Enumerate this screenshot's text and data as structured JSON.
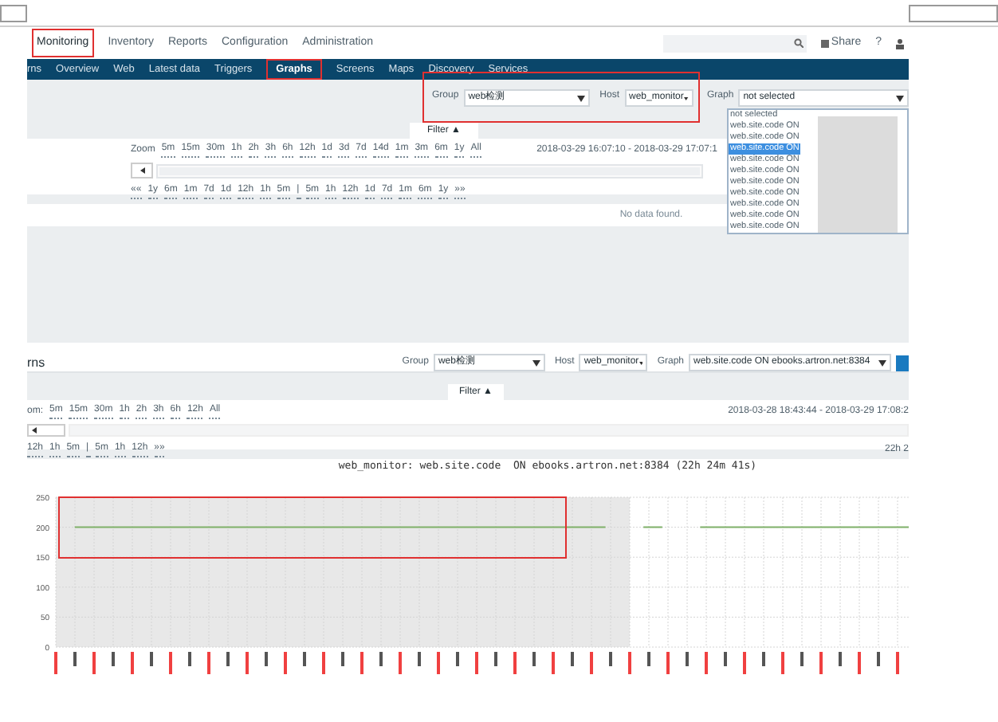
{
  "screenshot_1": {
    "top_menu": [
      {
        "label": "Monitoring",
        "selected": true
      },
      {
        "label": "Inventory",
        "selected": false
      },
      {
        "label": "Reports",
        "selected": false
      },
      {
        "label": "Configuration",
        "selected": false
      },
      {
        "label": "Administration",
        "selected": false
      }
    ],
    "share": "Share",
    "help": "?",
    "nav": [
      {
        "label": "rns",
        "selected": false
      },
      {
        "label": "Overview",
        "selected": false
      },
      {
        "label": "Web",
        "selected": false
      },
      {
        "label": "Latest data",
        "selected": false
      },
      {
        "label": "Triggers",
        "selected": false
      },
      {
        "label": "Graphs",
        "selected": true
      },
      {
        "label": "Screens",
        "selected": false
      },
      {
        "label": "Maps",
        "selected": false
      },
      {
        "label": "Discovery",
        "selected": false
      },
      {
        "label": "Services",
        "selected": false
      }
    ],
    "filter": {
      "group_label": "Group",
      "group_value": "web检测",
      "host_label": "Host",
      "host_value": "web_monitor",
      "graph_label": "Graph",
      "graph_value": "not selected",
      "graph_options": [
        {
          "label": "not selected",
          "selected": false
        },
        {
          "label": "web.site.code ON",
          "selected": false
        },
        {
          "label": "web.site.code ON",
          "selected": false
        },
        {
          "label": "web.site.code ON",
          "selected": true
        },
        {
          "label": "web.site.code ON",
          "selected": false
        },
        {
          "label": "web.site.code ON",
          "selected": false
        },
        {
          "label": "web.site.code ON",
          "selected": false
        },
        {
          "label": "web.site.code ON",
          "selected": false
        },
        {
          "label": "web.site.code ON",
          "selected": false
        },
        {
          "label": "web.site.code ON",
          "selected": false
        },
        {
          "label": "web.site.code ON",
          "selected": false
        }
      ]
    },
    "filter_tab": "Filter ▲",
    "zoom_label": "Zoom",
    "zoom_options": [
      "5m",
      "15m",
      "30m",
      "1h",
      "2h",
      "3h",
      "6h",
      "12h",
      "1d",
      "3d",
      "7d",
      "14d",
      "1m",
      "3m",
      "6m",
      "1y",
      "All"
    ],
    "period": "2018-03-29 16:07:10 - 2018-03-29 17:07:1",
    "slider": {
      "level": 1
    },
    "nav_links": [
      "««",
      "1y",
      "6m",
      "1m",
      "7d",
      "1d",
      "12h",
      "1h",
      "5m",
      "|",
      "5m",
      "1h",
      "12h",
      "1d",
      "7d",
      "1m",
      "6m",
      "1y",
      "»»"
    ],
    "message": "No data found."
  },
  "screenshot_2": {
    "title": "rns",
    "filter": {
      "group_label": "Group",
      "group_value": "web检测",
      "host_label": "Host",
      "host_value": "web_monitor",
      "graph_label": "Graph",
      "graph_value": "web.site.code ON ebooks.artron.net:8384"
    },
    "filter_tab": "Filter ▲",
    "zoom_label": "om:",
    "zoom_options": [
      "5m",
      "15m",
      "30m",
      "1h",
      "2h",
      "3h",
      "6h",
      "12h",
      "All"
    ],
    "period": "2018-03-28 18:43:44 - 2018-03-29 17:08:2",
    "slider": {
      "level": 1
    },
    "nav_links": [
      "12h",
      "1h",
      "5m",
      "|",
      "5m",
      "1h",
      "12h",
      "»»"
    ],
    "duration": "22h 2",
    "chart_data": {
      "type": "line",
      "grid": true,
      "title": "web_monitor: web.site.code  ON ebooks.artron.net:8384 (22h 24m 41s)",
      "ylim": [
        0,
        250
      ],
      "yticks": [
        0,
        50,
        100,
        150,
        200,
        250
      ],
      "series": [
        {
          "color": "#7fb069",
          "values": [
            null,
            200,
            200,
            200,
            200,
            200,
            200,
            200,
            200,
            200,
            200,
            200,
            200,
            200,
            200,
            200,
            200,
            200,
            200,
            200,
            200,
            200,
            200,
            200,
            200,
            200,
            200,
            200,
            200,
            200,
            null,
            200,
            200,
            null,
            200,
            200,
            200,
            200,
            200,
            200,
            200,
            200,
            200,
            200,
            200,
            200
          ]
        }
      ]
    }
  }
}
